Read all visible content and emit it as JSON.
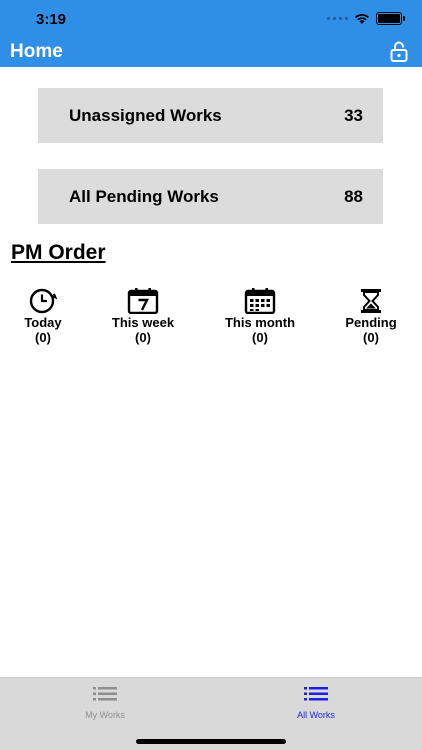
{
  "status_bar": {
    "time": "3:19"
  },
  "header": {
    "title": "Home"
  },
  "cards": [
    {
      "label": "Unassigned Works",
      "count": "33"
    },
    {
      "label": "All Pending Works",
      "count": "88"
    }
  ],
  "pm_order": {
    "title": "PM Order",
    "items": [
      {
        "label": "Today",
        "count": "(0)",
        "icon": "clock-icon"
      },
      {
        "label": "This week",
        "count": "(0)",
        "icon": "calendar-week-icon"
      },
      {
        "label": "This month",
        "count": "(0)",
        "icon": "calendar-month-icon"
      },
      {
        "label": "Pending",
        "count": "(0)",
        "icon": "hourglass-icon"
      }
    ]
  },
  "tabbar": {
    "tabs": [
      {
        "label": "My Works",
        "active": false
      },
      {
        "label": "All Works",
        "active": true
      }
    ]
  },
  "colors": {
    "header": "#2f8fe6",
    "card": "#dcdcdc",
    "active_tab": "#1e1ee6",
    "inactive_tab": "#8e8e8e"
  }
}
